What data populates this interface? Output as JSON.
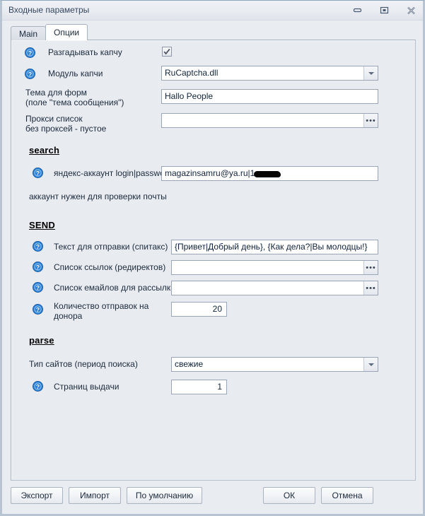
{
  "window": {
    "title": "Входные параметры",
    "controls": [
      {
        "name": "minimize-button",
        "glyph": "minimize-icon"
      },
      {
        "name": "restore-button",
        "glyph": "restore-icon"
      },
      {
        "name": "close-button",
        "glyph": "close-icon"
      }
    ]
  },
  "tabs": [
    {
      "label": "Main",
      "active": false
    },
    {
      "label": "Опции",
      "active": true
    }
  ],
  "form": {
    "solve_captcha": {
      "label": "Разгадывать капчу",
      "checked": true,
      "help": true
    },
    "captcha_module": {
      "label": "Модуль капчи",
      "value": "RuCaptcha.dll",
      "help": true
    },
    "form_subject": {
      "label": "Тема для форм\n(поле \"тема сообщения\")",
      "value": "Hallo People",
      "help": false
    },
    "proxy_list": {
      "label": "Прокси список\nбез проксей - пустое",
      "value": "",
      "help": false
    },
    "section_search": "search",
    "yandex_account": {
      "label": "яндекс-аккаунт login|password",
      "value": "magazinsamru@ya.ru|1",
      "redacted": true,
      "help": true
    },
    "account_note": "аккаунт нужен для проверки почты",
    "section_send": "SEND",
    "send_text": {
      "label": "Текст для отправки (спитакс)",
      "value": "{Привет|Добрый день}, {Как дела?|Вы молодцы!}",
      "help": true
    },
    "links_list": {
      "label": "Список ссылок (редиректов)",
      "value": "",
      "help": true
    },
    "emails_list": {
      "label": "Список емайлов для рассылки",
      "value": "",
      "help": true
    },
    "sends_per_donor": {
      "label": "Количество отправок на\nдонора",
      "value": "20",
      "help": true
    },
    "section_parse": "parse",
    "site_type": {
      "label": "Тип сайтов (период поиска)",
      "value": "свежие",
      "help": false
    },
    "result_pages": {
      "label": "Страниц выдачи",
      "value": "1",
      "help": true
    }
  },
  "buttons": {
    "export": "Экспорт",
    "import": "Импорт",
    "defaults": "По умолчанию",
    "ok": "ОК",
    "cancel": "Отмена"
  },
  "colors": {
    "panel_bg": "#e8ebf0",
    "field_bg": "#ffffff",
    "help_icon": "#2c7fd4",
    "border": "#a9b3c0"
  }
}
